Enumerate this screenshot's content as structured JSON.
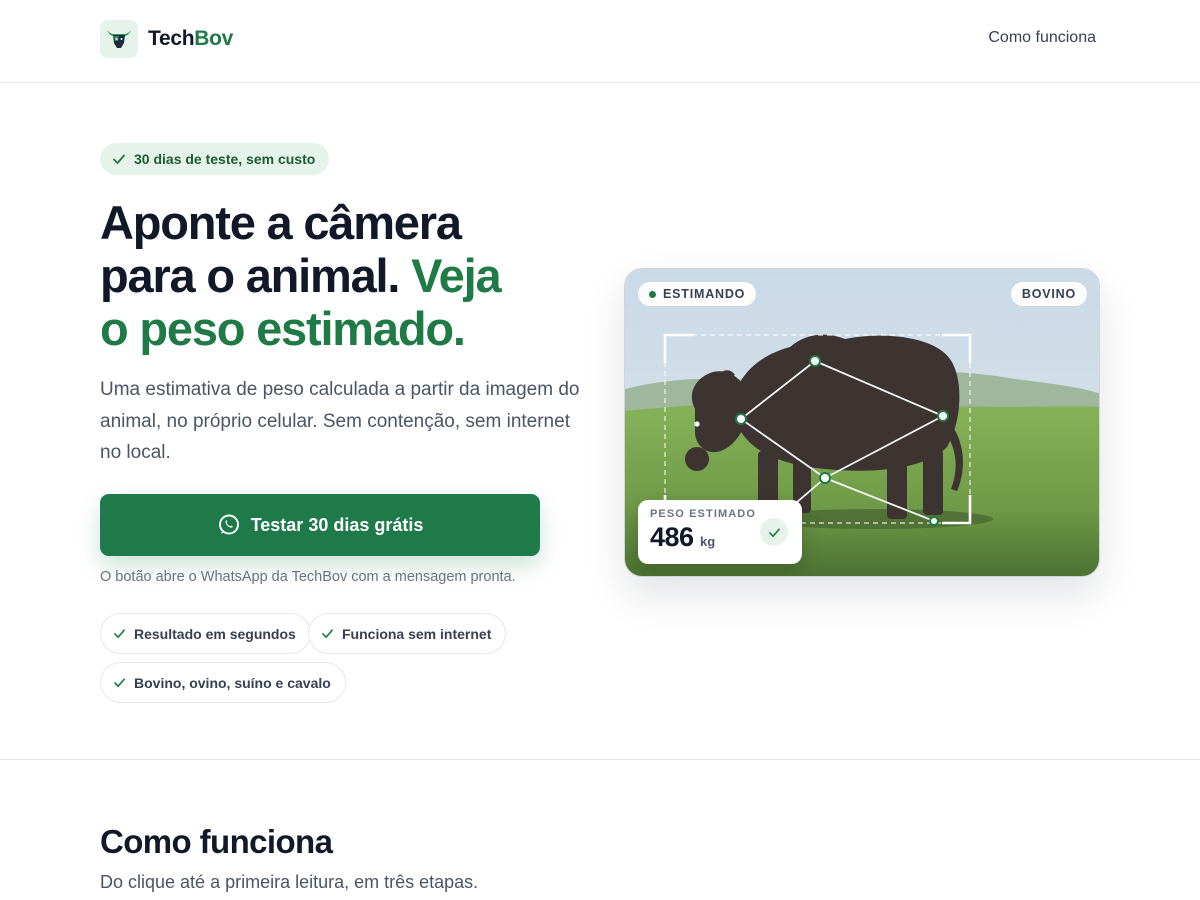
{
  "header": {
    "brand_part1": "Tech",
    "brand_part2": "Bov",
    "logo_icon": "bull-head-icon",
    "nav_link": "Como funciona"
  },
  "hero": {
    "badge": "30 dias de teste, sem custo",
    "title_line1": "Aponte a câmera",
    "title_line2a": "para o animal.",
    "title_line2b": "Veja",
    "title_line3": "o peso estimado.",
    "subtitle": "Uma estimativa de peso calculada a partir da imagem do animal, no próprio celular. Sem contenção, sem internet no local.",
    "cta_label": "Testar 30 dias grátis",
    "cta_icon": "whatsapp-icon",
    "cta_note": "O botão abre o WhatsApp da TechBov com a mensagem pronta.",
    "features": [
      "Resultado em segundos",
      "Funciona sem internet",
      "Bovino, ovino, suíno e cavalo"
    ]
  },
  "preview_card": {
    "status_tag": "ESTIMANDO",
    "species_tag": "BOVINO",
    "weight_label": "PESO ESTIMADO",
    "weight_value": "486",
    "weight_unit": "kg"
  },
  "how_it_works": {
    "title": "Como funciona",
    "subtitle": "Do clique até a primeira leitura, em três etapas."
  },
  "colors": {
    "brand_green": "#1f7a45",
    "text_dark": "#111827",
    "badge_bg": "#e6f3ea"
  }
}
